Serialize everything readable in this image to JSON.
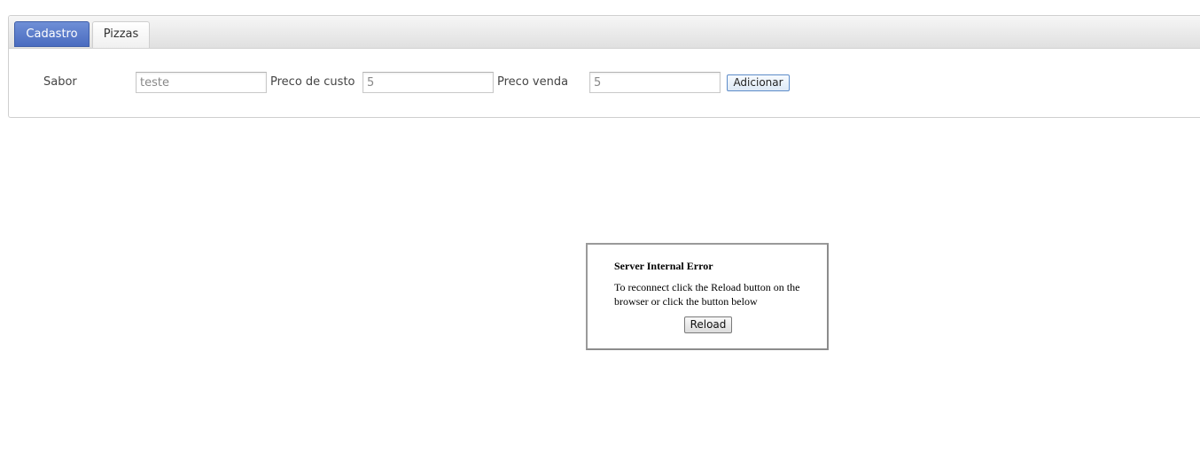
{
  "tabs": [
    {
      "label": "Cadastro",
      "active": true
    },
    {
      "label": "Pizzas",
      "active": false
    }
  ],
  "form": {
    "sabor_label": "Sabor",
    "sabor_value": "teste",
    "preco_custo_label": "Preco de custo",
    "preco_custo_value": "5",
    "preco_venda_label": "Preco venda",
    "preco_venda_value": "5",
    "add_button_label": "Adicionar"
  },
  "error_dialog": {
    "title": "Server Internal Error",
    "message": "To reconnect click the Reload button on the browser or click the button below",
    "reload_button_label": "Reload"
  },
  "colors": {
    "active_tab": "#4a6cc0",
    "tab_bar": "#e0e0e0",
    "add_button_border": "#5d8cc9"
  }
}
